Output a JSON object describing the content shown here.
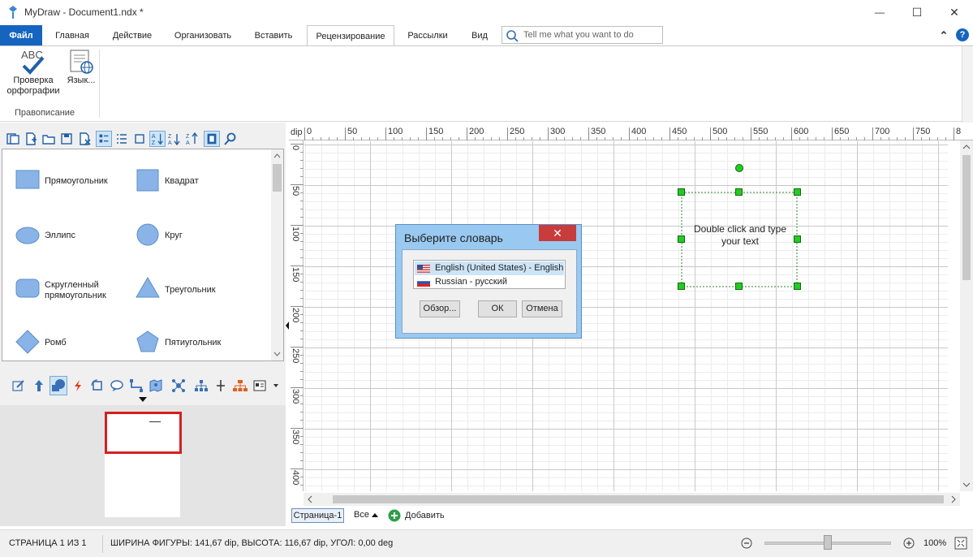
{
  "window": {
    "title": "MyDraw - Document1.ndx *",
    "minimize_glyph": "—",
    "maximize_glyph": "☐",
    "close_glyph": "✕"
  },
  "ribbon": {
    "tabs": [
      "Файл",
      "Главная",
      "Действие",
      "Организовать",
      "Вставить",
      "Рецензирование",
      "Рассылки",
      "Вид"
    ],
    "active_tab": "Рецензирование",
    "search_placeholder": "Tell me what you want to do",
    "collapse_glyph": "⌃",
    "help_glyph": "?",
    "spell_icon_text": "ABC",
    "spell_label_1": "Проверка",
    "spell_label_2": "орфографии",
    "language_label": "Язык...",
    "group_label": "Правописание"
  },
  "shapes": {
    "items": [
      {
        "label": "Прямоугольник",
        "icon": "rectangle-icon"
      },
      {
        "label": "Квадрат",
        "icon": "square-icon"
      },
      {
        "label": "Эллипс",
        "icon": "ellipse-icon"
      },
      {
        "label": "Круг",
        "icon": "circle-icon"
      },
      {
        "label": "Скругленный прямоугольник",
        "icon": "rounded-rectangle-icon"
      },
      {
        "label": "Треугольник",
        "icon": "triangle-icon"
      },
      {
        "label": "Ромб",
        "icon": "rhombus-icon"
      },
      {
        "label": "Пятиугольник",
        "icon": "pentagon-icon"
      }
    ],
    "label_line_1": "Скругленный",
    "label_line_2": "прямоугольник"
  },
  "ruler": {
    "unit": "dip",
    "top_ticks": [
      "0",
      "50",
      "100",
      "150",
      "200",
      "250",
      "300",
      "350",
      "400",
      "450",
      "500",
      "550",
      "600",
      "650",
      "700",
      "750",
      "8"
    ],
    "left_ticks": [
      "0",
      "50",
      "100",
      "150",
      "200",
      "250",
      "300",
      "350",
      "400"
    ]
  },
  "canvas": {
    "shape_text_1": "Double click and type",
    "shape_text_2": "your text"
  },
  "dialog": {
    "title": "Выберите словарь",
    "close_glyph": "✕",
    "languages": [
      {
        "label": "English (United States) - English",
        "selected": true
      },
      {
        "label": "Russian - русский",
        "selected": false
      }
    ],
    "browse_label": "Обзор...",
    "ok_label": "ОК",
    "cancel_label": "Отмена"
  },
  "pages": {
    "current_tab": "Страница-1",
    "all_label": "Все",
    "add_label": "Добавить"
  },
  "status": {
    "page_info": "СТРАНИЦА 1 ИЗ 1",
    "shape_info": "ШИРИНА ФИГУРЫ: 141,67 dip, ВЫСОТА: 116,67 dip, УГОЛ: 0,00 deg",
    "zoom_level": "100%",
    "zoom_fraction": 0.5
  },
  "colors": {
    "accent": "#1565c0",
    "shape_fill": "#8ab4e8",
    "handle": "#22cc22",
    "dialog_frame": "#99c9f0",
    "navigator_view": "#d42020"
  }
}
